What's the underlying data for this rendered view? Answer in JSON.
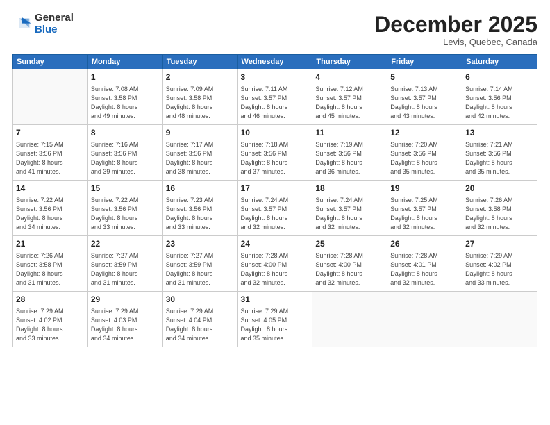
{
  "logo": {
    "general": "General",
    "blue": "Blue"
  },
  "title": "December 2025",
  "location": "Levis, Quebec, Canada",
  "days_of_week": [
    "Sunday",
    "Monday",
    "Tuesday",
    "Wednesday",
    "Thursday",
    "Friday",
    "Saturday"
  ],
  "weeks": [
    [
      {
        "day": "",
        "info": ""
      },
      {
        "day": "1",
        "info": "Sunrise: 7:08 AM\nSunset: 3:58 PM\nDaylight: 8 hours\nand 49 minutes."
      },
      {
        "day": "2",
        "info": "Sunrise: 7:09 AM\nSunset: 3:58 PM\nDaylight: 8 hours\nand 48 minutes."
      },
      {
        "day": "3",
        "info": "Sunrise: 7:11 AM\nSunset: 3:57 PM\nDaylight: 8 hours\nand 46 minutes."
      },
      {
        "day": "4",
        "info": "Sunrise: 7:12 AM\nSunset: 3:57 PM\nDaylight: 8 hours\nand 45 minutes."
      },
      {
        "day": "5",
        "info": "Sunrise: 7:13 AM\nSunset: 3:57 PM\nDaylight: 8 hours\nand 43 minutes."
      },
      {
        "day": "6",
        "info": "Sunrise: 7:14 AM\nSunset: 3:56 PM\nDaylight: 8 hours\nand 42 minutes."
      }
    ],
    [
      {
        "day": "7",
        "info": "Sunrise: 7:15 AM\nSunset: 3:56 PM\nDaylight: 8 hours\nand 41 minutes."
      },
      {
        "day": "8",
        "info": "Sunrise: 7:16 AM\nSunset: 3:56 PM\nDaylight: 8 hours\nand 39 minutes."
      },
      {
        "day": "9",
        "info": "Sunrise: 7:17 AM\nSunset: 3:56 PM\nDaylight: 8 hours\nand 38 minutes."
      },
      {
        "day": "10",
        "info": "Sunrise: 7:18 AM\nSunset: 3:56 PM\nDaylight: 8 hours\nand 37 minutes."
      },
      {
        "day": "11",
        "info": "Sunrise: 7:19 AM\nSunset: 3:56 PM\nDaylight: 8 hours\nand 36 minutes."
      },
      {
        "day": "12",
        "info": "Sunrise: 7:20 AM\nSunset: 3:56 PM\nDaylight: 8 hours\nand 35 minutes."
      },
      {
        "day": "13",
        "info": "Sunrise: 7:21 AM\nSunset: 3:56 PM\nDaylight: 8 hours\nand 35 minutes."
      }
    ],
    [
      {
        "day": "14",
        "info": "Sunrise: 7:22 AM\nSunset: 3:56 PM\nDaylight: 8 hours\nand 34 minutes."
      },
      {
        "day": "15",
        "info": "Sunrise: 7:22 AM\nSunset: 3:56 PM\nDaylight: 8 hours\nand 33 minutes."
      },
      {
        "day": "16",
        "info": "Sunrise: 7:23 AM\nSunset: 3:56 PM\nDaylight: 8 hours\nand 33 minutes."
      },
      {
        "day": "17",
        "info": "Sunrise: 7:24 AM\nSunset: 3:57 PM\nDaylight: 8 hours\nand 32 minutes."
      },
      {
        "day": "18",
        "info": "Sunrise: 7:24 AM\nSunset: 3:57 PM\nDaylight: 8 hours\nand 32 minutes."
      },
      {
        "day": "19",
        "info": "Sunrise: 7:25 AM\nSunset: 3:57 PM\nDaylight: 8 hours\nand 32 minutes."
      },
      {
        "day": "20",
        "info": "Sunrise: 7:26 AM\nSunset: 3:58 PM\nDaylight: 8 hours\nand 32 minutes."
      }
    ],
    [
      {
        "day": "21",
        "info": "Sunrise: 7:26 AM\nSunset: 3:58 PM\nDaylight: 8 hours\nand 31 minutes."
      },
      {
        "day": "22",
        "info": "Sunrise: 7:27 AM\nSunset: 3:59 PM\nDaylight: 8 hours\nand 31 minutes."
      },
      {
        "day": "23",
        "info": "Sunrise: 7:27 AM\nSunset: 3:59 PM\nDaylight: 8 hours\nand 31 minutes."
      },
      {
        "day": "24",
        "info": "Sunrise: 7:28 AM\nSunset: 4:00 PM\nDaylight: 8 hours\nand 32 minutes."
      },
      {
        "day": "25",
        "info": "Sunrise: 7:28 AM\nSunset: 4:00 PM\nDaylight: 8 hours\nand 32 minutes."
      },
      {
        "day": "26",
        "info": "Sunrise: 7:28 AM\nSunset: 4:01 PM\nDaylight: 8 hours\nand 32 minutes."
      },
      {
        "day": "27",
        "info": "Sunrise: 7:29 AM\nSunset: 4:02 PM\nDaylight: 8 hours\nand 33 minutes."
      }
    ],
    [
      {
        "day": "28",
        "info": "Sunrise: 7:29 AM\nSunset: 4:02 PM\nDaylight: 8 hours\nand 33 minutes."
      },
      {
        "day": "29",
        "info": "Sunrise: 7:29 AM\nSunset: 4:03 PM\nDaylight: 8 hours\nand 34 minutes."
      },
      {
        "day": "30",
        "info": "Sunrise: 7:29 AM\nSunset: 4:04 PM\nDaylight: 8 hours\nand 34 minutes."
      },
      {
        "day": "31",
        "info": "Sunrise: 7:29 AM\nSunset: 4:05 PM\nDaylight: 8 hours\nand 35 minutes."
      },
      {
        "day": "",
        "info": ""
      },
      {
        "day": "",
        "info": ""
      },
      {
        "day": "",
        "info": ""
      }
    ]
  ]
}
